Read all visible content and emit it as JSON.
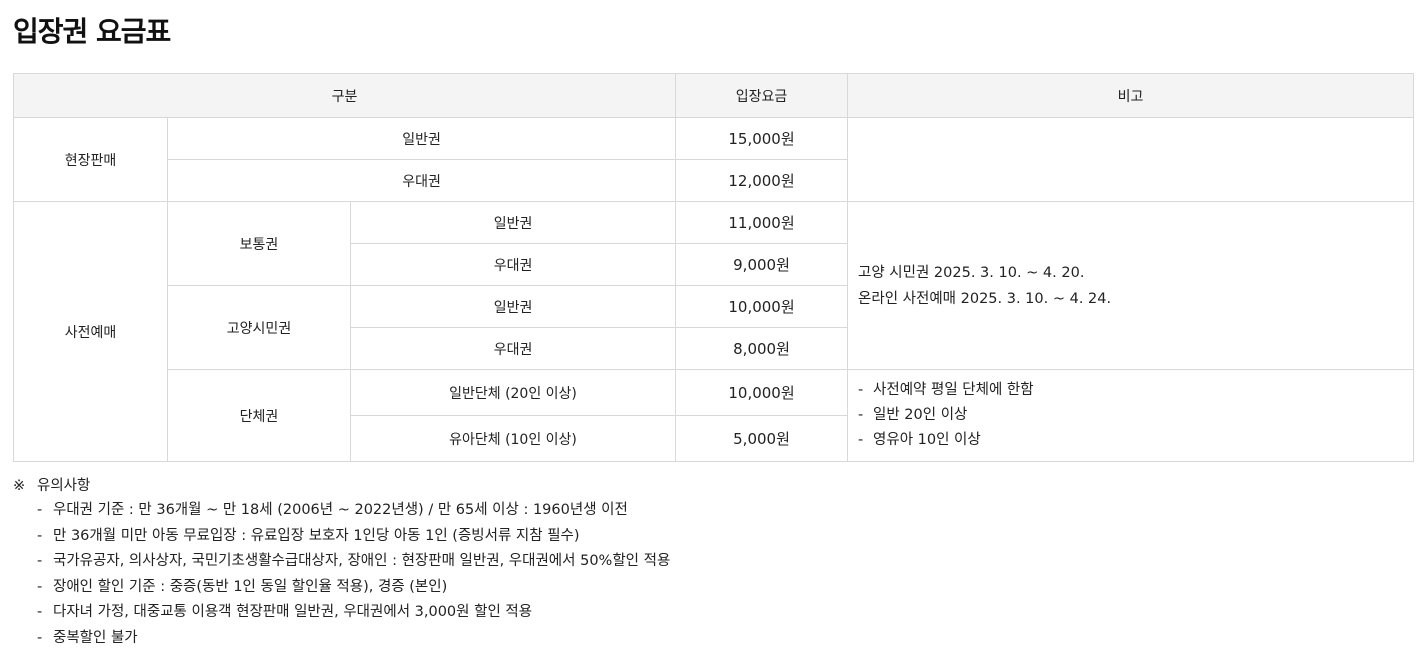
{
  "title": "입장권 요금표",
  "table": {
    "headers": {
      "category": "구분",
      "fee": "입장요금",
      "remark": "비고"
    },
    "onsite": {
      "label": "현장판매",
      "rows": [
        {
          "type": "일반권",
          "price": "15,000원"
        },
        {
          "type": "우대권",
          "price": "12,000원"
        }
      ]
    },
    "presale": {
      "label": "사전예매",
      "groups": [
        {
          "label": "보통권",
          "rows": [
            {
              "type": "일반권",
              "price": "11,000원"
            },
            {
              "type": "우대권",
              "price": "9,000원"
            }
          ]
        },
        {
          "label": "고양시민권",
          "rows": [
            {
              "type": "일반권",
              "price": "10,000원"
            },
            {
              "type": "우대권",
              "price": "8,000원"
            }
          ]
        },
        {
          "label": "단체권",
          "rows": [
            {
              "type": "일반단체 (20인 이상)",
              "price": "10,000원"
            },
            {
              "type": "유아단체 (10인 이상)",
              "price": "5,000원"
            }
          ]
        }
      ],
      "remark_dates": [
        "고양 시민권 2025. 3. 10. ~ 4. 20.",
        "온라인 사전예매 2025. 3. 10. ~ 4. 24."
      ],
      "remark_group": [
        "사전예약 평일 단체에 한함",
        "일반 20인 이상",
        "영유아 10인 이상"
      ]
    }
  },
  "notice": {
    "mark": "※",
    "title": "유의사항",
    "items": [
      "우대권 기준 : 만 36개월 ~ 만 18세 (2006년 ~ 2022년생) / 만 65세 이상 : 1960년생 이전",
      "만 36개월 미만 아동 무료입장 : 유료입장 보호자 1인당 아동 1인 (증빙서류 지참 필수)",
      "국가유공자, 의사상자, 국민기초생활수급대상자, 장애인 : 현장판매 일반권, 우대권에서 50%할인 적용",
      "장애인 할인 기준 : 중증(동반 1인 동일 할인율 적용), 경증 (본인)",
      "다자녀 가정, 대중교통 이용객 현장판매 일반권, 우대권에서 3,000원 할인 적용",
      "중복할인 불가"
    ]
  }
}
